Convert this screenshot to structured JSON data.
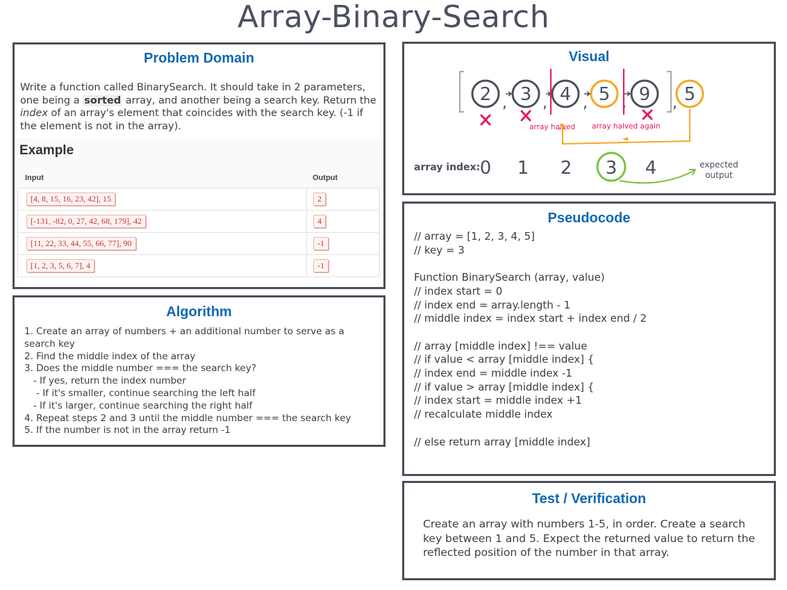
{
  "title": "Array-Binary-Search",
  "problem_domain": {
    "title": "Problem Domain",
    "text_1": "Write a function called BinarySearch. It should take in 2 parameters, one being a ",
    "text_sorted": "sorted",
    "text_2": " array, and another being a search key. Return the ",
    "text_index": "index",
    "text_3": " of an array's element that coincides with the search key. (-1 if the element is not in the array).",
    "example": {
      "title": "Example",
      "col_input": "Input",
      "col_output": "Output",
      "rows": [
        {
          "input": "[4, 8, 15, 16, 23, 42], 15",
          "output": "2"
        },
        {
          "input": "[-131, -82, 0, 27, 42, 68, 179], 42",
          "output": "4"
        },
        {
          "input": "[11, 22, 33, 44, 55, 66, 77], 90",
          "output": "-1"
        },
        {
          "input": "[1, 2, 3, 5, 6, 7], 4",
          "output": "-1"
        }
      ]
    }
  },
  "algorithm": {
    "title": "Algorithm",
    "lines": [
      "1. Create an array of numbers + an additional number to serve as a",
      "search key",
      "2. Find the middle index of the array",
      "3. Does the middle number === the search key?",
      "   - If yes, return the index number",
      "    - If it's smaller, continue searching the left half",
      "   - If it's larger, continue searching the right half",
      "4. Repeat steps 2 and 3 until the middle number === the search key",
      "5. If the number is not in the array return -1"
    ]
  },
  "visual": {
    "title": "Visual",
    "array_values": [
      "2",
      "3",
      "4",
      "5",
      "9"
    ],
    "key_value": "5",
    "label_halved": "array halved",
    "label_halved_again": "array halved again",
    "index_label": "array index:",
    "indices": [
      "0",
      "1",
      "2",
      "3",
      "4"
    ],
    "expected_label_1": "expected",
    "expected_label_2": "output",
    "colors": {
      "dark": "#4a4f5a",
      "orange": "#f5a623",
      "red": "#e8185d",
      "green": "#7cc242"
    }
  },
  "pseudocode": {
    "title": "Pseudocode",
    "lines": [
      "// array = [1, 2, 3, 4, 5]",
      "// key = 3",
      "",
      "Function BinarySearch (array, value)",
      "// index start = 0",
      "// index end = array.length - 1",
      "// middle index = index start + index end / 2",
      "",
      "// array [middle index] !== value",
      "// if value < array [middle index] {",
      "// index end = middle index -1",
      "// if value > array [middle index] {",
      "// index start = middle index +1",
      "// recalculate middle index",
      "",
      "// else return array [middle index]"
    ]
  },
  "test": {
    "title": "Test / Verification",
    "text": "Create an array with numbers 1-5, in order. Create a search key between 1 and 5. Expect the returned value to return the reflected position of the number in that array."
  }
}
